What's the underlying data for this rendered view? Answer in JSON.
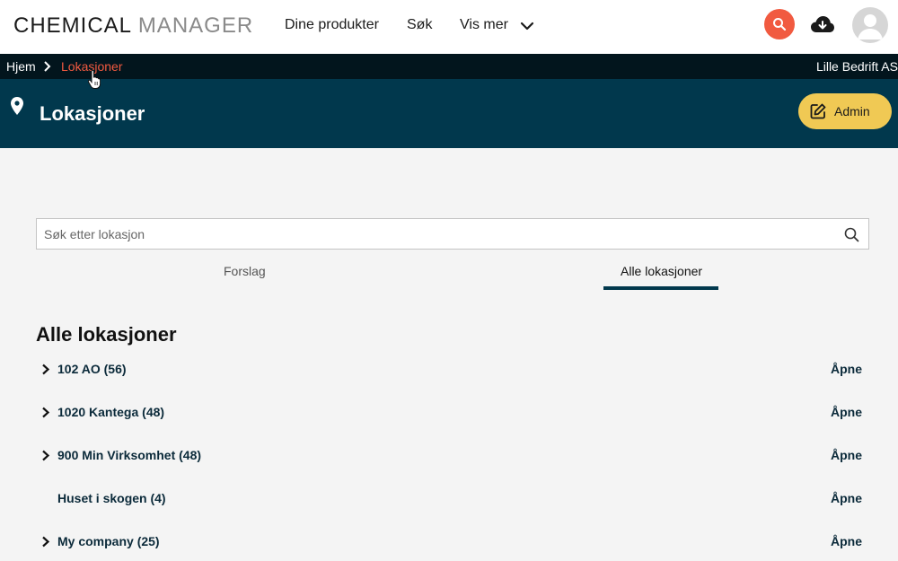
{
  "header": {
    "logo_part1": "CHEMICAL",
    "logo_part2": "MANAGER",
    "nav": {
      "products": "Dine produkter",
      "search": "Søk",
      "more": "Vis mer"
    },
    "icons": {
      "search": "search-icon",
      "download": "cloud-download-icon",
      "avatar": "user-avatar-icon",
      "more": "chevron-down-icon"
    },
    "colors": {
      "search_button": "#f15a40"
    }
  },
  "breadcrumb": {
    "home": "Hjem",
    "current": "Lokasjoner",
    "company": "Lille Bedrift AS"
  },
  "banner": {
    "title": "Lokasjoner",
    "admin_label": "Admin",
    "icon": "location-pin-icon",
    "colors": {
      "background": "#01384d",
      "admin_button": "#f0c954"
    }
  },
  "search": {
    "placeholder": "Søk etter lokasjon",
    "value": ""
  },
  "tabs": [
    {
      "label": "Forslag",
      "active": false
    },
    {
      "label": "Alle lokasjoner",
      "active": true
    }
  ],
  "section_title": "Alle lokasjoner",
  "locations": [
    {
      "label": "102 AO (56)",
      "expandable": true,
      "action": "Åpne"
    },
    {
      "label": "1020 Kantega (48)",
      "expandable": true,
      "action": "Åpne"
    },
    {
      "label": "900 Min Virksomhet (48)",
      "expandable": true,
      "action": "Åpne"
    },
    {
      "label": "Huset i skogen (4)",
      "expandable": false,
      "action": "Åpne"
    },
    {
      "label": "My company (25)",
      "expandable": true,
      "action": "Åpne"
    }
  ]
}
